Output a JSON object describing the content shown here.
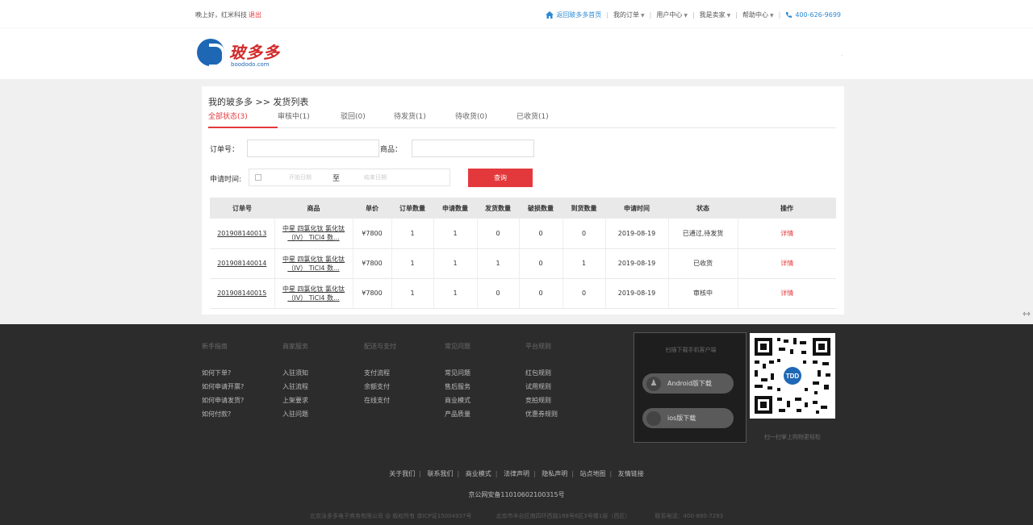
{
  "topbar": {
    "greeting": "晚上好，红米科技",
    "logout": "退出",
    "home_link": "返回玻多多首页",
    "links": [
      "我的订单",
      "用户中心",
      "我是卖家",
      "帮助中心"
    ],
    "phone": "400-626-9699"
  },
  "logo": {
    "brand_cn": "玻多多",
    "brand_en": "boododo.com"
  },
  "header": {
    "dot": "·"
  },
  "breadcrumb": "我的玻多多 >> 发货列表",
  "tabs": [
    {
      "label": "全部状态(3)",
      "active": true
    },
    {
      "label": "审核中(1)"
    },
    {
      "label": "驳回(0)"
    },
    {
      "label": "待发货(1)"
    },
    {
      "label": "待收货(0)"
    },
    {
      "label": "已收货(1)"
    }
  ],
  "filters": {
    "order_no_label": "订单号：",
    "product_label": "商品：",
    "apply_time_label": "申请时间:",
    "start_placeholder": "开始日期",
    "to": "至",
    "end_placeholder": "结束日期",
    "query_button": "查询"
  },
  "table": {
    "headers": [
      "订单号",
      "商品",
      "单价",
      "订单数量",
      "申请数量",
      "发货数量",
      "破损数量",
      "到货数量",
      "申请时间",
      "状态",
      "操作"
    ],
    "rows": [
      {
        "order_no": "201908140013",
        "product_line1": "中星 四氯化钛 氯化钛",
        "product_line2": "（IV） TiCl4 数...",
        "price": "¥7800",
        "order_qty": "1",
        "apply_qty": "1",
        "ship_qty": "0",
        "damage_qty": "0",
        "arrive_qty": "0",
        "apply_time": "2019-08-19",
        "status": "已通过,待发货",
        "action": "详情"
      },
      {
        "order_no": "201908140014",
        "product_line1": "中星 四氯化钛 氯化钛",
        "product_line2": "（IV） TiCl4 数...",
        "price": "¥7800",
        "order_qty": "1",
        "apply_qty": "1",
        "ship_qty": "1",
        "damage_qty": "0",
        "arrive_qty": "1",
        "apply_time": "2019-08-19",
        "status": "已收货",
        "action": "详情"
      },
      {
        "order_no": "201908140015",
        "product_line1": "中星 四氯化钛 氯化钛",
        "product_line2": "（IV） TiCl4 数...",
        "price": "¥7800",
        "order_qty": "1",
        "apply_qty": "1",
        "ship_qty": "0",
        "damage_qty": "0",
        "arrive_qty": "0",
        "apply_time": "2019-08-19",
        "status": "审核中",
        "action": "详情"
      }
    ]
  },
  "footer": {
    "columns": [
      {
        "head": "新手指南",
        "items": [
          "如何下单?",
          "如何申请开票?",
          "如何申请发货?",
          "如何付款?"
        ]
      },
      {
        "head": "商家服务",
        "items": [
          "入驻须知",
          "入驻流程",
          "上架要求",
          "入驻问题"
        ]
      },
      {
        "head": "配送与支付",
        "items": [
          "支付流程",
          "余额支付",
          "在线支付"
        ]
      },
      {
        "head": "常见问题",
        "items": [
          "常见问题",
          "售后服务",
          "商业模式",
          "产品质量"
        ]
      },
      {
        "head": "平台规则",
        "items": [
          "红包规则",
          "试用规则",
          "竞拍规则",
          "优惠券规则"
        ]
      }
    ],
    "app_scan": "扫描下载手机客户端",
    "android_button": "Android版下载",
    "ios_button": "ios版下载",
    "qr_caption": "扫一扫掌上购物更轻松",
    "links": [
      "关于我们",
      "联系我们",
      "商业模式",
      "法律声明",
      "隐私声明",
      "站点地图",
      "友情链接"
    ],
    "icp": "京公网安备11010602100315号",
    "copyright": "北京泳多多电子商务有限公司 @ 版权所有 京ICP证15004937号",
    "address": "北京市丰台区南四环西路188号6区3号楼1层（西区）",
    "contact": "联系电话：400-880-7283"
  },
  "colors": {
    "accent": "#e4393c",
    "link_blue": "#2a8ad4",
    "footer_bg": "#2c2c2c"
  }
}
